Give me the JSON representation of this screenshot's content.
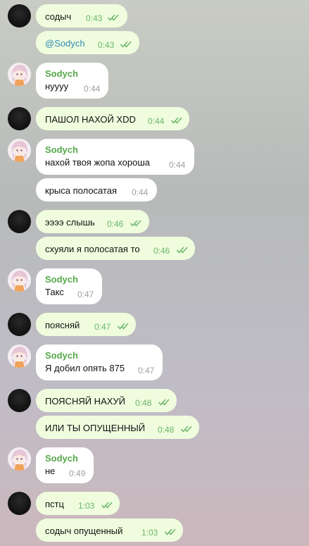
{
  "colors": {
    "outgoing_bubble": "#effdde",
    "incoming_bubble": "#ffffff",
    "sender_name": "#56a84a",
    "outgoing_time": "#6cb56c",
    "incoming_time": "#a0a0a0",
    "mention": "#2f8ab6"
  },
  "messages": [
    {
      "text": "содыч",
      "time": "0:43",
      "direction": "out",
      "read": true
    },
    {
      "text": "@Sodych",
      "time": "0:43",
      "direction": "out",
      "read": true
    },
    {
      "sender": "Sodych",
      "text": "нуууу",
      "time": "0:44",
      "direction": "in"
    },
    {
      "text": "ПАШОЛ НАХОЙ XDD",
      "time": "0:44",
      "direction": "out",
      "read": true
    },
    {
      "sender": "Sodych",
      "text": "нахой твоя жопа хороша",
      "time": "0:44",
      "direction": "in"
    },
    {
      "text": "крыса полосатая",
      "time": "0:44",
      "direction": "in"
    },
    {
      "text": "ээээ слышь",
      "time": "0:46",
      "direction": "out",
      "read": true
    },
    {
      "text": "схуяли я полосатая то",
      "time": "0:46",
      "direction": "out",
      "read": true
    },
    {
      "sender": "Sodych",
      "text": "Такс",
      "time": "0:47",
      "direction": "in"
    },
    {
      "text": "поясняй",
      "time": "0:47",
      "direction": "out",
      "read": true
    },
    {
      "sender": "Sodych",
      "text": "Я добил опять 875",
      "time": "0:47",
      "direction": "in"
    },
    {
      "text": "ПОЯСНЯЙ НАХУЙ",
      "time": "0:48",
      "direction": "out",
      "read": true
    },
    {
      "text": "ИЛИ ТЫ ОПУЩЕННЫЙ",
      "time": "0:48",
      "direction": "out",
      "read": true
    },
    {
      "sender": "Sodych",
      "text": "не",
      "time": "0:49",
      "direction": "in"
    },
    {
      "text": "пстц",
      "time": "1:03",
      "direction": "out",
      "read": true
    },
    {
      "text": "содыч опущенный",
      "time": "1:03",
      "direction": "out",
      "read": true
    }
  ]
}
